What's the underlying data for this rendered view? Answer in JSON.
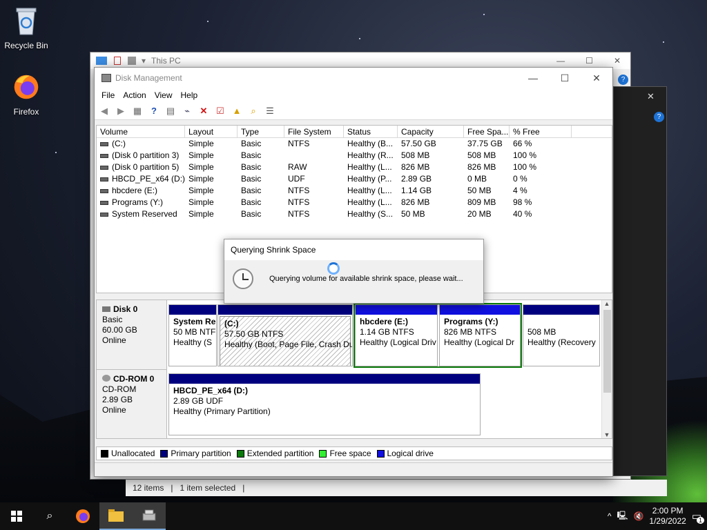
{
  "desktop": {
    "icons": [
      {
        "label": "Recycle Bin",
        "icon": "recycle-bin-icon"
      },
      {
        "label": "Firefox",
        "icon": "firefox-icon"
      }
    ]
  },
  "explorer": {
    "title": "This PC",
    "status": {
      "items": "12 items",
      "selected": "1 item selected"
    }
  },
  "window": {
    "title": "Disk Management",
    "menu": [
      "File",
      "Action",
      "View",
      "Help"
    ]
  },
  "volumes": {
    "columns": [
      "Volume",
      "Layout",
      "Type",
      "File System",
      "Status",
      "Capacity",
      "Free Spa...",
      "% Free"
    ],
    "rows": [
      [
        "(C:)",
        "Simple",
        "Basic",
        "NTFS",
        "Healthy (B...",
        "57.50 GB",
        "37.75 GB",
        "66 %"
      ],
      [
        "(Disk 0 partition 3)",
        "Simple",
        "Basic",
        "",
        "Healthy (R...",
        "508 MB",
        "508 MB",
        "100 %"
      ],
      [
        "(Disk 0 partition 5)",
        "Simple",
        "Basic",
        "RAW",
        "Healthy (L...",
        "826 MB",
        "826 MB",
        "100 %"
      ],
      [
        "HBCD_PE_x64 (D:)",
        "Simple",
        "Basic",
        "UDF",
        "Healthy (P...",
        "2.89 GB",
        "0 MB",
        "0 %"
      ],
      [
        "hbcdere (E:)",
        "Simple",
        "Basic",
        "NTFS",
        "Healthy (L...",
        "1.14 GB",
        "50 MB",
        "4 %"
      ],
      [
        "Programs (Y:)",
        "Simple",
        "Basic",
        "NTFS",
        "Healthy (L...",
        "826 MB",
        "809 MB",
        "98 %"
      ],
      [
        "System Reserved",
        "Simple",
        "Basic",
        "NTFS",
        "Healthy (S...",
        "50 MB",
        "20 MB",
        "40 %"
      ]
    ]
  },
  "disks": {
    "disk0": {
      "name": "Disk 0",
      "type": "Basic",
      "size": "60.00 GB",
      "state": "Online",
      "partitions": [
        {
          "name": "System Re",
          "detail": "50 MB NTFS",
          "status": "Healthy (S"
        },
        {
          "name": "(C:)",
          "detail": "57.50 GB NTFS",
          "status": "Healthy (Boot, Page File, Crash Du"
        },
        {
          "name": "hbcdere  (E:)",
          "detail": "1.14 GB NTFS",
          "status": "Healthy (Logical Driv"
        },
        {
          "name": "Programs  (Y:)",
          "detail": "826 MB NTFS",
          "status": "Healthy (Logical Dr"
        },
        {
          "name": "",
          "detail": "508 MB",
          "status": "Healthy (Recovery"
        }
      ]
    },
    "cdrom0": {
      "name": "CD-ROM 0",
      "type": "CD-ROM",
      "size": "2.89 GB",
      "state": "Online",
      "partition": {
        "name": "HBCD_PE_x64  (D:)",
        "detail": "2.89 GB UDF",
        "status": "Healthy (Primary Partition)"
      }
    }
  },
  "legend": [
    {
      "label": "Unallocated",
      "color": "#000000"
    },
    {
      "label": "Primary partition",
      "color": "#00007f"
    },
    {
      "label": "Extended partition",
      "color": "#0a7a0a"
    },
    {
      "label": "Free space",
      "color": "#33ee33"
    },
    {
      "label": "Logical drive",
      "color": "#1010e0"
    }
  ],
  "dialog": {
    "title": "Querying Shrink Space",
    "message": "Querying volume for available shrink space, please wait..."
  },
  "taskbar": {
    "time": "2:00 PM",
    "date": "1/29/2022",
    "notifications": "1"
  }
}
